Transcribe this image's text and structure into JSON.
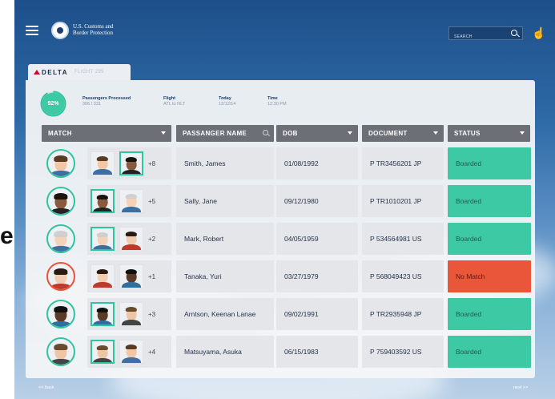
{
  "header": {
    "agency_line1": "U.S. Customs and",
    "agency_line2": "Border Protection",
    "search_placeholder": "SEARCH"
  },
  "tab": {
    "airline": "DELTA",
    "flight": "FLIGHT 295"
  },
  "summary": {
    "progress_percent_text": "92%",
    "progress_fraction": 0.92,
    "passengers_label": "Passengers Processed",
    "passengers_value": "306 / 331",
    "flight_label": "Flight",
    "flight_value": "ATL to NLT",
    "today_label": "Today",
    "today_value": "12/12/14",
    "time_label": "Time",
    "time_value": "12:30 PM"
  },
  "columns": {
    "match": "MATCH",
    "name": "PASSANGER NAME",
    "dob": "DOB",
    "document": "DOCUMENT",
    "status": "STATUS"
  },
  "rows": [
    {
      "extra": "+8",
      "name": "Smith, James",
      "dob": "01/08/1992",
      "document": "P TR3456201 JP",
      "status": "Boarded",
      "ok": true
    },
    {
      "extra": "+5",
      "name": "Sally, Jane",
      "dob": "09/12/1980",
      "document": "P TR1010201 JP",
      "status": "Boarded",
      "ok": true
    },
    {
      "extra": "+2",
      "name": "Mark, Robert",
      "dob": "04/05/1959",
      "document": "P 534564981 US",
      "status": "Boarded",
      "ok": true
    },
    {
      "extra": "+1",
      "name": "Tanaka, Yuri",
      "dob": "03/27/1979",
      "document": "P 568049423 US",
      "status": "No Match",
      "ok": false
    },
    {
      "extra": "+3",
      "name": "Arntson, Keenan Lanae",
      "dob": "09/02/1991",
      "document": "P TR2935948 JP",
      "status": "Boarded",
      "ok": true
    },
    {
      "extra": "+4",
      "name": "Matsuyama, Asuka",
      "dob": "06/15/1983",
      "document": "P 759403592 US",
      "status": "Boarded",
      "ok": true
    }
  ],
  "footer": {
    "back": "<< back",
    "next": "next >>"
  },
  "edge_text": "e",
  "colors": {
    "accent_green": "#3ec9a5",
    "alert_red": "#e9563a",
    "header_gray": "#6c6f76",
    "brand_navy": "#1b3b6a",
    "delta_red": "#c8102e"
  }
}
